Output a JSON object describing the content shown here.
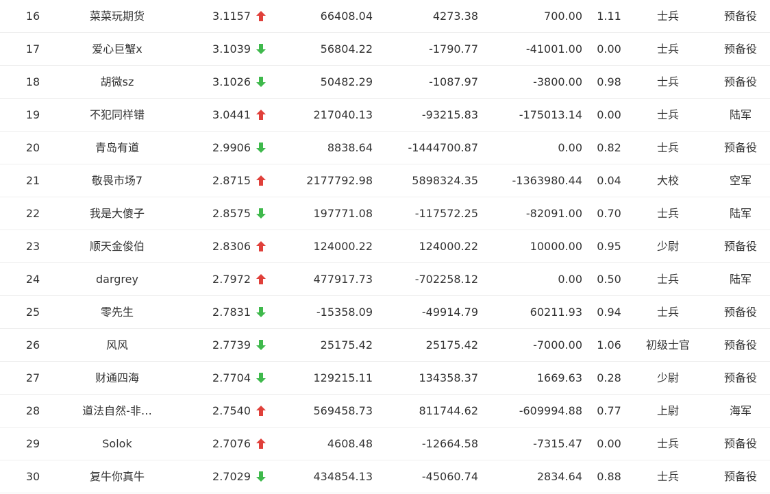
{
  "colors": {
    "up": "#e0403a",
    "down": "#3fb94c",
    "text": "#333333"
  },
  "rows": [
    {
      "rank": "16",
      "name": "菜菜玩期货",
      "score": "3.1157",
      "trend": "up",
      "v1": "66408.04",
      "v2": "4273.38",
      "v3": "700.00",
      "ratio": "1.11",
      "rank_name": "士兵",
      "army": "预备役"
    },
    {
      "rank": "17",
      "name": "爱心巨蟹x",
      "score": "3.1039",
      "trend": "down",
      "v1": "56804.22",
      "v2": "-1790.77",
      "v3": "-41001.00",
      "ratio": "0.00",
      "rank_name": "士兵",
      "army": "预备役"
    },
    {
      "rank": "18",
      "name": "胡微sz",
      "score": "3.1026",
      "trend": "down",
      "v1": "50482.29",
      "v2": "-1087.97",
      "v3": "-3800.00",
      "ratio": "0.98",
      "rank_name": "士兵",
      "army": "预备役"
    },
    {
      "rank": "19",
      "name": "不犯同样错",
      "score": "3.0441",
      "trend": "up",
      "v1": "217040.13",
      "v2": "-93215.83",
      "v3": "-175013.14",
      "ratio": "0.00",
      "rank_name": "士兵",
      "army": "陆军"
    },
    {
      "rank": "20",
      "name": "青岛有道",
      "score": "2.9906",
      "trend": "down",
      "v1": "8838.64",
      "v2": "-1444700.87",
      "v3": "0.00",
      "ratio": "0.82",
      "rank_name": "士兵",
      "army": "预备役"
    },
    {
      "rank": "21",
      "name": "敬畏市场7",
      "score": "2.8715",
      "trend": "up",
      "v1": "2177792.98",
      "v2": "5898324.35",
      "v3": "-1363980.44",
      "ratio": "0.04",
      "rank_name": "大校",
      "army": "空军"
    },
    {
      "rank": "22",
      "name": "我是大傻子",
      "score": "2.8575",
      "trend": "down",
      "v1": "197771.08",
      "v2": "-117572.25",
      "v3": "-82091.00",
      "ratio": "0.70",
      "rank_name": "士兵",
      "army": "陆军"
    },
    {
      "rank": "23",
      "name": "顺天金俊伯",
      "score": "2.8306",
      "trend": "up",
      "v1": "124000.22",
      "v2": "124000.22",
      "v3": "10000.00",
      "ratio": "0.95",
      "rank_name": "少尉",
      "army": "预备役"
    },
    {
      "rank": "24",
      "name": "dargrey",
      "score": "2.7972",
      "trend": "up",
      "v1": "477917.73",
      "v2": "-702258.12",
      "v3": "0.00",
      "ratio": "0.50",
      "rank_name": "士兵",
      "army": "陆军"
    },
    {
      "rank": "25",
      "name": "零先生",
      "score": "2.7831",
      "trend": "down",
      "v1": "-15358.09",
      "v2": "-49914.79",
      "v3": "60211.93",
      "ratio": "0.94",
      "rank_name": "士兵",
      "army": "预备役"
    },
    {
      "rank": "26",
      "name": "风风",
      "score": "2.7739",
      "trend": "down",
      "v1": "25175.42",
      "v2": "25175.42",
      "v3": "-7000.00",
      "ratio": "1.06",
      "rank_name": "初级士官",
      "army": "预备役"
    },
    {
      "rank": "27",
      "name": "财通四海",
      "score": "2.7704",
      "trend": "down",
      "v1": "129215.11",
      "v2": "134358.37",
      "v3": "1669.63",
      "ratio": "0.28",
      "rank_name": "少尉",
      "army": "预备役"
    },
    {
      "rank": "28",
      "name": "道法自然-非…",
      "score": "2.7540",
      "trend": "up",
      "v1": "569458.73",
      "v2": "811744.62",
      "v3": "-609994.88",
      "ratio": "0.77",
      "rank_name": "上尉",
      "army": "海军"
    },
    {
      "rank": "29",
      "name": "Solok",
      "score": "2.7076",
      "trend": "up",
      "v1": "4608.48",
      "v2": "-12664.58",
      "v3": "-7315.47",
      "ratio": "0.00",
      "rank_name": "士兵",
      "army": "预备役"
    },
    {
      "rank": "30",
      "name": "复牛你真牛",
      "score": "2.7029",
      "trend": "down",
      "v1": "434854.13",
      "v2": "-45060.74",
      "v3": "2834.64",
      "ratio": "0.88",
      "rank_name": "士兵",
      "army": "预备役"
    }
  ]
}
